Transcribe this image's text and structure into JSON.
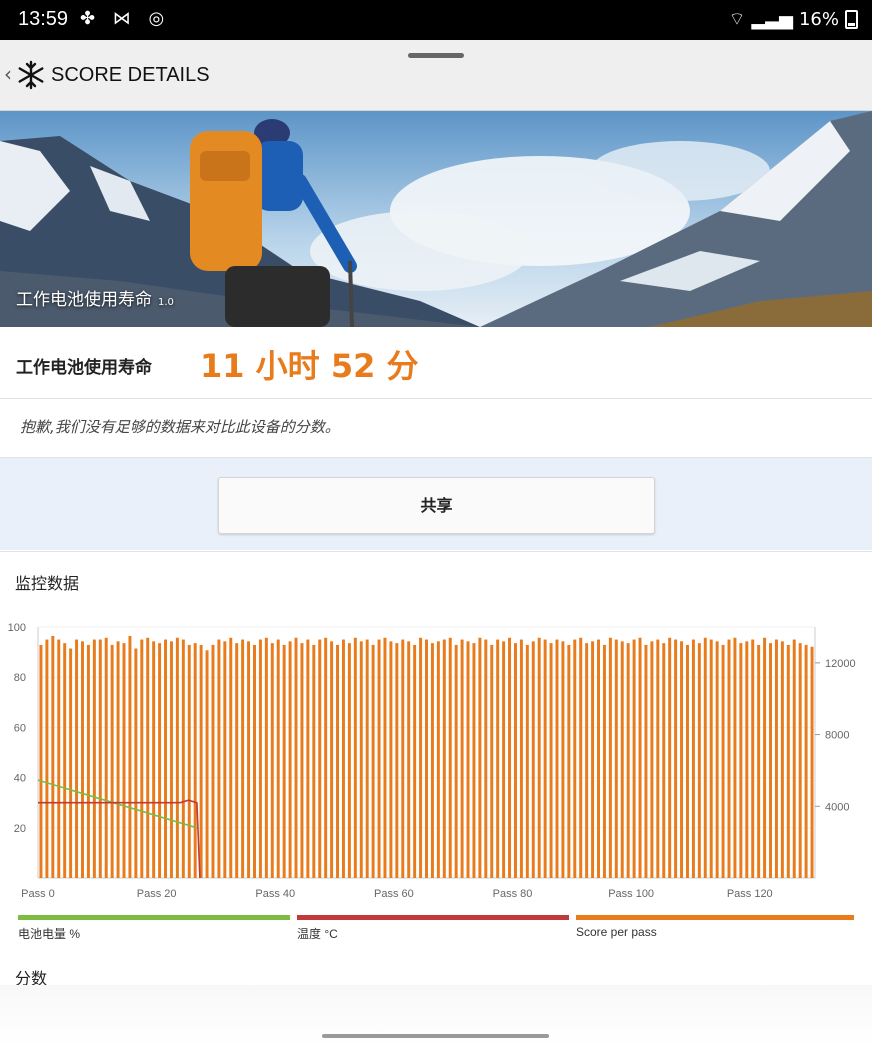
{
  "status_bar": {
    "time": "13:59",
    "battery": "16%"
  },
  "app_bar": {
    "title": "SCORE DETAILS"
  },
  "hero": {
    "caption": "工作电池使用寿命",
    "version": "1.0"
  },
  "result": {
    "label": "工作电池使用寿命",
    "value": "11 小时 52 分"
  },
  "note": "抱歉,我们没有足够的数据来对比此设备的分数。",
  "share_label": "共享",
  "monitor": {
    "title": "监控数据"
  },
  "chart_data": {
    "type": "bar",
    "x_tick_labels": [
      "Pass 0",
      "Pass 20",
      "Pass 40",
      "Pass 60",
      "Pass 80",
      "Pass 100",
      "Pass 120"
    ],
    "left_ticks": [
      "100",
      "80",
      "60",
      "40",
      "20"
    ],
    "right_ticks": [
      "12000",
      "8000",
      "4000"
    ],
    "ylim_left": [
      0,
      100
    ],
    "ylim_right": [
      0,
      14000
    ],
    "series": [
      {
        "name": "电池电量 %",
        "color": "#7dbb42",
        "axis": "left",
        "values": [
          39,
          38,
          37,
          36,
          35,
          34,
          33,
          32,
          31,
          30,
          29,
          28,
          27,
          26,
          25,
          24,
          23,
          22,
          21,
          20
        ]
      },
      {
        "name": "温度 °C",
        "color": "#c0393b",
        "axis": "left",
        "values": [
          30,
          30,
          30,
          30,
          30,
          30,
          30,
          30,
          30,
          30,
          30,
          30,
          30,
          30,
          30,
          30,
          30,
          30,
          31,
          30
        ]
      },
      {
        "name": "Score per pass",
        "color": "#e87b1c",
        "axis": "right",
        "values": [
          13000,
          13300,
          13500,
          13300,
          13100,
          12800,
          13300,
          13200,
          13000,
          13300,
          13300,
          13400,
          13000,
          13200,
          13100,
          13500,
          12800,
          13300,
          13400,
          13200,
          13100,
          13300,
          13200,
          13400,
          13300,
          13000,
          13100,
          13000,
          12700,
          13000,
          13300,
          13200,
          13400,
          13100,
          13300,
          13200,
          13000,
          13300,
          13400,
          13100,
          13300,
          13000,
          13200,
          13400,
          13100,
          13300,
          13000,
          13300,
          13400,
          13200,
          13000,
          13300,
          13100,
          13400,
          13200,
          13300,
          13000,
          13300,
          13400,
          13200,
          13100,
          13300,
          13200,
          13000,
          13400,
          13300,
          13100,
          13200,
          13300,
          13400,
          13000,
          13300,
          13200,
          13100,
          13400,
          13300,
          13000,
          13300,
          13200,
          13400,
          13100,
          13300,
          13000,
          13200,
          13400,
          13300,
          13100,
          13300,
          13200,
          13000,
          13300,
          13400,
          13100,
          13200,
          13300,
          13000,
          13400,
          13300,
          13200,
          13100,
          13300,
          13400,
          13000,
          13200,
          13300,
          13100,
          13400,
          13300,
          13200,
          13000,
          13300,
          13100,
          13400,
          13300,
          13200,
          13000,
          13300,
          13400,
          13100,
          13200,
          13300,
          13000,
          13400,
          13100,
          13300,
          13200,
          13000,
          13300,
          13100,
          13000,
          12900
        ]
      }
    ],
    "legend": [
      {
        "label": "电池电量 %",
        "color": "#7dbb42"
      },
      {
        "label": "温度 °C",
        "color": "#c0393b"
      },
      {
        "label": "Score per pass",
        "color": "#e87b1c"
      }
    ]
  },
  "scores_title": "分数"
}
